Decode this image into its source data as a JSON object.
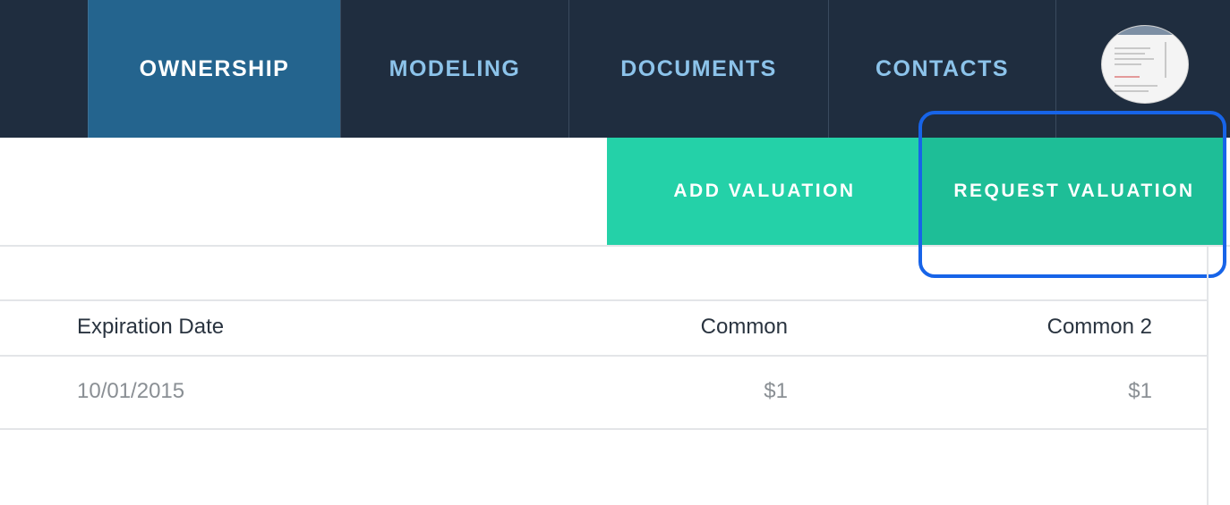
{
  "nav": {
    "tabs": [
      {
        "label": "OWNERSHIP",
        "active": true
      },
      {
        "label": "MODELING",
        "active": false
      },
      {
        "label": "DOCUMENTS",
        "active": false
      },
      {
        "label": "CONTACTS",
        "active": false
      }
    ]
  },
  "actions": {
    "add_valuation": "ADD VALUATION",
    "request_valuation": "REQUEST VALUATION"
  },
  "table": {
    "columns": [
      "Expiration Date",
      "Common",
      "Common 2"
    ],
    "rows": [
      [
        "10/01/2015",
        "$1",
        "$1"
      ]
    ]
  },
  "colors": {
    "nav_bg": "#1f2d3f",
    "active_tab": "#24648e",
    "add_button": "#24d1a8",
    "request_button": "#1ebe97",
    "highlight": "#1764e8"
  }
}
